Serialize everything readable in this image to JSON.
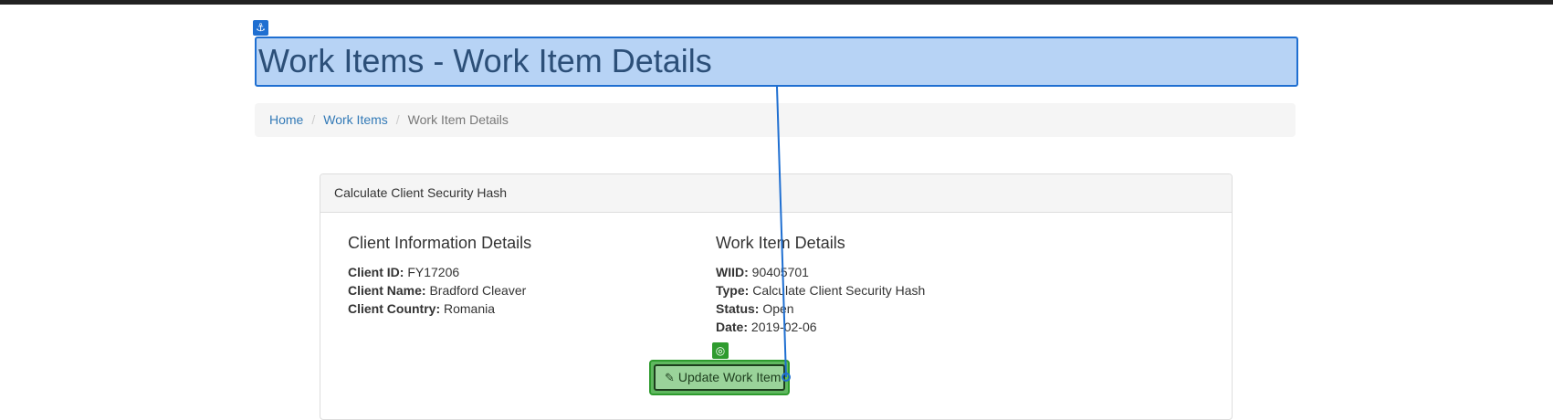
{
  "page": {
    "title": "Work Items - Work Item Details"
  },
  "breadcrumb": {
    "items": [
      "Home",
      "Work Items"
    ],
    "active": "Work Item Details",
    "separator": "/"
  },
  "panel": {
    "heading": "Calculate Client Security Hash",
    "client": {
      "title": "Client Information Details",
      "fields": [
        {
          "label": "Client ID:",
          "value": "FY17206"
        },
        {
          "label": "Client Name:",
          "value": "Bradford Cleaver"
        },
        {
          "label": "Client Country:",
          "value": "Romania"
        }
      ]
    },
    "work_item": {
      "title": "Work Item Details",
      "fields": [
        {
          "label": "WIID:",
          "value": "90405701"
        },
        {
          "label": "Type:",
          "value": "Calculate Client Security Hash"
        },
        {
          "label": "Status:",
          "value": "Open"
        },
        {
          "label": "Date:",
          "value": "2019-02-06"
        }
      ]
    },
    "update_button": {
      "label": "Update Work Item",
      "icon": "pencil-icon"
    }
  },
  "overlay": {
    "anchor_icon": "anchor-icon",
    "target_icon": "target-icon",
    "colors": {
      "anchor": "#1f6fd1",
      "target": "#2e9b2e"
    }
  }
}
